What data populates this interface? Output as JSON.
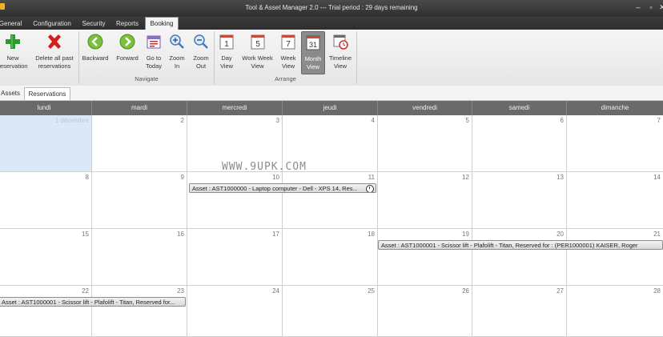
{
  "window": {
    "title": "Tool & Asset Manager 2.0 --- Trial period : 29 days remaining",
    "controls": {
      "minimize": "–",
      "maximize": "▫",
      "close": "✕"
    }
  },
  "menu": {
    "tabs": [
      "General",
      "Configuration",
      "Security",
      "Reports",
      "Booking"
    ],
    "active": "Booking"
  },
  "ribbon": {
    "new_reservation": "New\nreservation",
    "delete_all": "Delete all past\nreservations",
    "backward": "Backward",
    "forward": "Forward",
    "goto_today": "Go to\nToday",
    "zoom_in": "Zoom\nIn",
    "zoom_out": "Zoom\nOut",
    "day_view": "Day\nView",
    "work_week_view": "Work Week\nView",
    "week_view": "Week\nView",
    "month_view": "Month\nView",
    "timeline_view": "Timeline\nView",
    "group_navigate": "Navigate",
    "group_arrange": "Arrange",
    "icon_numbers": {
      "day": "1",
      "work_week": "5",
      "week": "7",
      "month": "31"
    }
  },
  "subtabs": [
    "Assets",
    "Reservations"
  ],
  "calendar": {
    "days": [
      "lundi",
      "mardi",
      "mercredi",
      "jeudi",
      "vendredi",
      "samedi",
      "dimanche"
    ],
    "weeks": [
      [
        "",
        "2",
        "3",
        "4",
        "5",
        "6",
        "7"
      ],
      [
        "8",
        "9",
        "10",
        "11",
        "12",
        "13",
        "14"
      ],
      [
        "15",
        "16",
        "17",
        "18",
        "19",
        "20",
        "21"
      ],
      [
        "22",
        "23",
        "24",
        "25",
        "26",
        "27",
        "28"
      ]
    ],
    "today_cell": "1 décembre",
    "events": {
      "e1": "Asset : AST1000000 - Laptop computer - Dell - XPS 14, Res...",
      "e2": "Asset : AST1000001 - Scissor lift - Plafolift - Titan, Reserved for : (PER1000001) KAISER, Roger",
      "e3": "Asset : AST1000001 - Scissor lift - Plafolift - Titan, Reserved for..."
    }
  },
  "watermark": "WWW.9UPK.COM",
  "colors": {
    "accent_green": "#3aa53a",
    "accent_red": "#d62020",
    "today_bg": "#dbe8f7",
    "header_bg": "#6a6a6a"
  }
}
